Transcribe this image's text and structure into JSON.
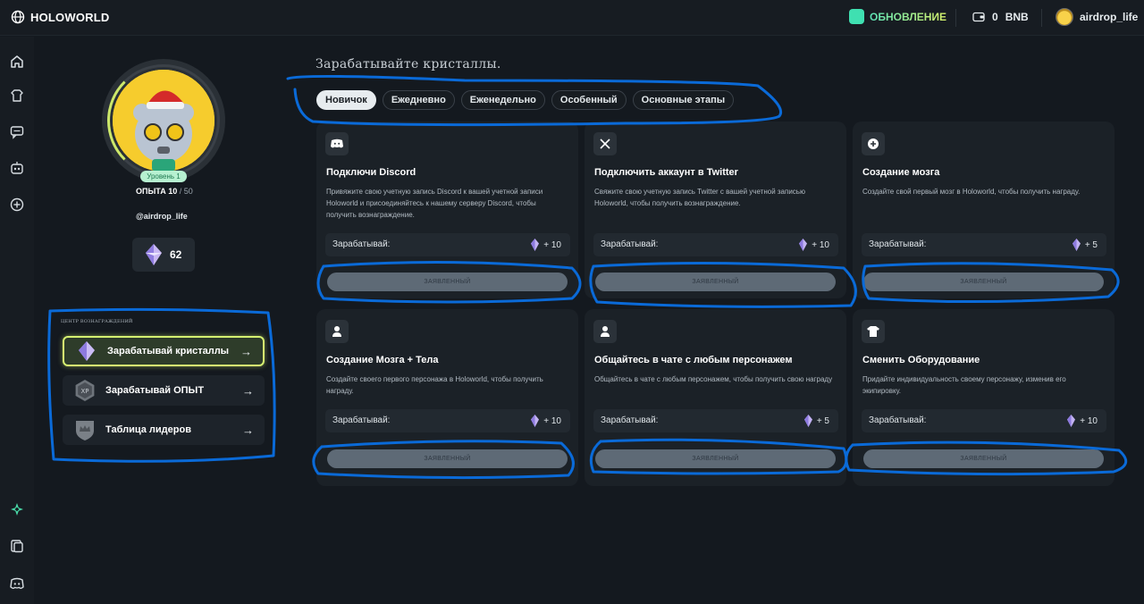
{
  "app": {
    "name": "HOLOWORLD"
  },
  "header": {
    "update_label": "ОБНОВЛЕНИЕ",
    "wallet_balance": "0",
    "wallet_currency": "BNB",
    "username": "airdrop_life"
  },
  "rail": {
    "icons": [
      "home-icon",
      "character-icon",
      "chat-icon",
      "robot-icon",
      "plus-circle-icon",
      "sparkle-icon",
      "gallery-icon",
      "discord-icon"
    ]
  },
  "profile": {
    "level_label": "Уровень 1",
    "xp_label": "ОПЫТА 10",
    "xp_max": "/ 50",
    "xp_progress": 0.2,
    "handle": "@airdrop_life",
    "crystals": "62"
  },
  "rewards_center": {
    "title": "ЦЕНТР ВОЗНАГРАЖДЕНИЙ",
    "items": [
      {
        "label": "Зарабатывай кристаллы",
        "icon": "crystal-icon",
        "active": true
      },
      {
        "label": "Зарабатывай ОПЫТ",
        "icon": "xp-icon",
        "active": false
      },
      {
        "label": "Таблица лидеров",
        "icon": "crown-shield-icon",
        "active": false
      }
    ]
  },
  "main": {
    "title": "Зарабатывайте кристаллы.",
    "tabs": [
      "Новичок",
      "Ежедневно",
      "Еженедельно",
      "Особенный",
      "Основные этапы"
    ],
    "active_tab": 0,
    "earn_label": "Зарабатывай:",
    "claimed_label": "ЗАЯВЛЕННЫЙ",
    "cards": [
      {
        "icon": "discord-icon",
        "title": "Подключи Discord",
        "desc": "Привяжите свою учетную запись Discord к вашей учетной записи Holoworld и присоединяйтесь к нашему серверу Discord, чтобы получить вознаграждение.",
        "reward": "+ 10"
      },
      {
        "icon": "x-twitter-icon",
        "title": "Подключить аккаунт в Twitter",
        "desc": "Свяжите свою учетную запись Twitter с вашей учетной записью Holoworld, чтобы получить вознаграждение.",
        "reward": "+ 10"
      },
      {
        "icon": "plus-circle-icon",
        "title": "Создание мозга",
        "desc": "Создайте свой первый мозг в Holoworld, чтобы получить награду.",
        "reward": "+ 5"
      },
      {
        "icon": "person-icon",
        "title": "Создание Мозга + Тела",
        "desc": "Создайте своего первого персонажа в Holoworld, чтобы получить награду.",
        "reward": "+ 10"
      },
      {
        "icon": "person-icon",
        "title": "Общайтесь в чате с любым персонажем",
        "desc": "Общайтесь в чате с любым персонажем, чтобы получить свою награду",
        "reward": "+ 5"
      },
      {
        "icon": "shirt-icon",
        "title": "Сменить Оборудование",
        "desc": "Придайте индивидуальность своему персонажу, изменив его экипировку.",
        "reward": "+ 10"
      }
    ]
  },
  "colors": {
    "accent": "#d6f071",
    "annotation": "#0a6ad8",
    "claim_button": "#5e6a76"
  }
}
